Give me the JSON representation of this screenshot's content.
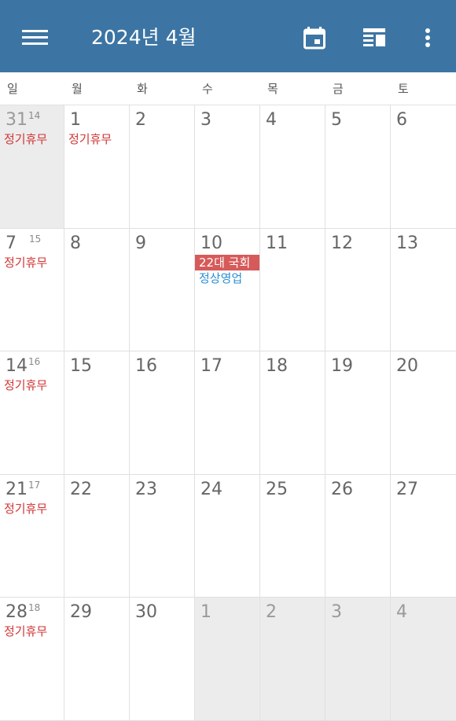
{
  "header": {
    "title": "2024년 4월",
    "icons": [
      "menu-icon",
      "calendar-today-icon",
      "view-layout-icon",
      "more-vert-icon"
    ]
  },
  "colors": {
    "appbar": "#3c75a3",
    "holiday_text": "#d23535",
    "event_block": "#d65a5a",
    "business_text": "#2a8fd4",
    "other_month_bg": "#ececec"
  },
  "weekdays": [
    "일",
    "월",
    "화",
    "수",
    "목",
    "금",
    "토"
  ],
  "weeks": [
    [
      {
        "day": "31",
        "lunar": "14",
        "other": true,
        "events": [
          {
            "text": "정기휴무",
            "style": "red"
          }
        ]
      },
      {
        "day": "1",
        "events": [
          {
            "text": "정기휴무",
            "style": "red"
          }
        ]
      },
      {
        "day": "2",
        "events": []
      },
      {
        "day": "3",
        "events": []
      },
      {
        "day": "4",
        "events": []
      },
      {
        "day": "5",
        "events": []
      },
      {
        "day": "6",
        "events": []
      }
    ],
    [
      {
        "day": "7",
        "lunar": "15",
        "events": [
          {
            "text": "정기휴무",
            "style": "red"
          }
        ]
      },
      {
        "day": "8",
        "events": []
      },
      {
        "day": "9",
        "events": []
      },
      {
        "day": "10",
        "events": [
          {
            "text": "22대 국회",
            "style": "block"
          },
          {
            "text": "정상영업",
            "style": "blue"
          }
        ]
      },
      {
        "day": "11",
        "events": []
      },
      {
        "day": "12",
        "events": []
      },
      {
        "day": "13",
        "events": []
      }
    ],
    [
      {
        "day": "14",
        "lunar": "16",
        "events": [
          {
            "text": "정기휴무",
            "style": "red"
          }
        ]
      },
      {
        "day": "15",
        "events": []
      },
      {
        "day": "16",
        "events": []
      },
      {
        "day": "17",
        "events": []
      },
      {
        "day": "18",
        "events": []
      },
      {
        "day": "19",
        "events": []
      },
      {
        "day": "20",
        "events": []
      }
    ],
    [
      {
        "day": "21",
        "lunar": "17",
        "events": [
          {
            "text": "정기휴무",
            "style": "red"
          }
        ]
      },
      {
        "day": "22",
        "events": []
      },
      {
        "day": "23",
        "events": []
      },
      {
        "day": "24",
        "events": []
      },
      {
        "day": "25",
        "events": []
      },
      {
        "day": "26",
        "events": []
      },
      {
        "day": "27",
        "events": []
      }
    ],
    [
      {
        "day": "28",
        "lunar": "18",
        "events": [
          {
            "text": "정기휴무",
            "style": "red"
          }
        ]
      },
      {
        "day": "29",
        "events": []
      },
      {
        "day": "30",
        "events": []
      },
      {
        "day": "1",
        "other": true,
        "events": []
      },
      {
        "day": "2",
        "other": true,
        "events": []
      },
      {
        "day": "3",
        "other": true,
        "events": []
      },
      {
        "day": "4",
        "other": true,
        "events": []
      }
    ]
  ]
}
